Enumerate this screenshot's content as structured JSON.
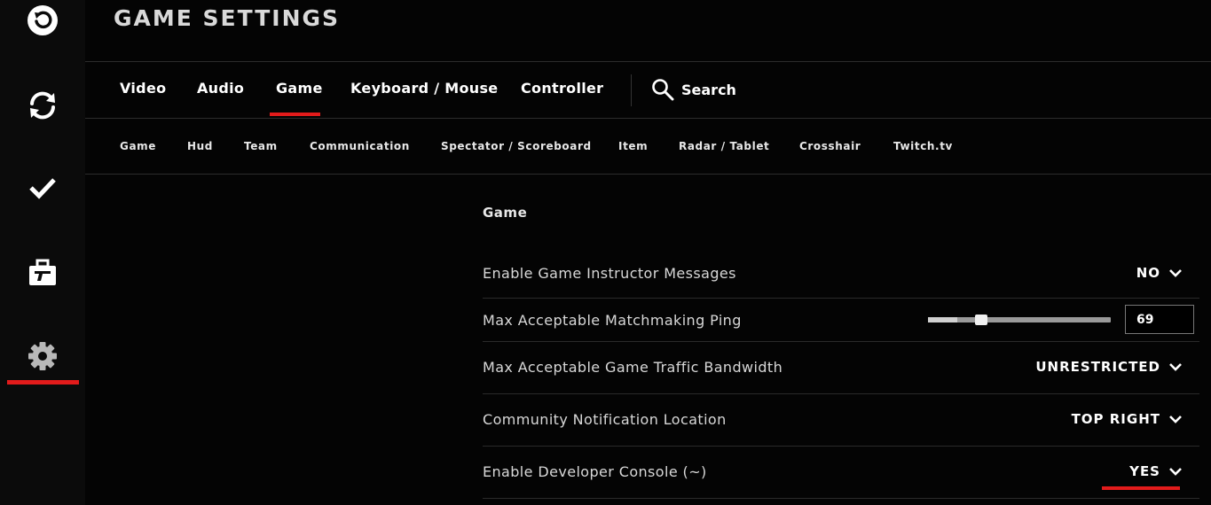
{
  "sidebar": {
    "items": [
      {
        "icon": "back-icon"
      },
      {
        "icon": "refresh-icon"
      },
      {
        "icon": "checkmark-icon"
      },
      {
        "icon": "briefcase-icon"
      },
      {
        "icon": "gear-icon"
      }
    ],
    "active": "gear-icon"
  },
  "header": {
    "title": "GAME SETTINGS"
  },
  "tabs": {
    "items": [
      {
        "label": "Video"
      },
      {
        "label": "Audio"
      },
      {
        "label": "Game"
      },
      {
        "label": "Keyboard / Mouse"
      },
      {
        "label": "Controller"
      }
    ],
    "active": "Game",
    "search_label": "Search"
  },
  "subtabs": {
    "items": [
      {
        "label": "Game"
      },
      {
        "label": "Hud"
      },
      {
        "label": "Team"
      },
      {
        "label": "Communication"
      },
      {
        "label": "Spectator / Scoreboard"
      },
      {
        "label": "Item"
      },
      {
        "label": "Radar / Tablet"
      },
      {
        "label": "Crosshair"
      },
      {
        "label": "Twitch.tv"
      }
    ]
  },
  "section": {
    "title": "Game",
    "settings": [
      {
        "label": "Enable Game Instructor Messages",
        "value": "NO"
      },
      {
        "label": "Max Acceptable Matchmaking Ping",
        "value": "69",
        "slider_fraction": 0.16
      },
      {
        "label": "Max Acceptable Game Traffic Bandwidth",
        "value": "UNRESTRICTED"
      },
      {
        "label": "Community Notification Location",
        "value": "TOP RIGHT"
      },
      {
        "label": "Enable Developer Console (~)",
        "value": "YES"
      }
    ]
  },
  "colors": {
    "accent": "#e21b1b",
    "background": "#040404",
    "sidebar": "#0b0b0b"
  }
}
